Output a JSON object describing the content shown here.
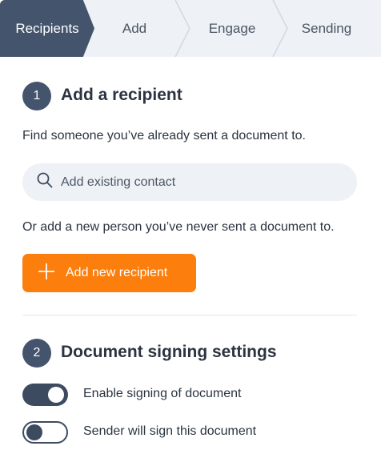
{
  "steps": [
    {
      "label": "Recipients",
      "active": true
    },
    {
      "label": "Add",
      "active": false
    },
    {
      "label": "Engage",
      "active": false
    },
    {
      "label": "Sending",
      "active": false
    }
  ],
  "section1": {
    "number": "1",
    "title": "Add a recipient",
    "find_text": "Find someone you’ve already sent a document to.",
    "search_placeholder": "Add existing contact",
    "or_text": "Or add a new person you’ve never sent a document to.",
    "add_button_label": "Add new recipient"
  },
  "section2": {
    "number": "2",
    "title": "Document signing settings",
    "toggles": [
      {
        "label": "Enable signing of document",
        "on": true
      },
      {
        "label": "Sender will sign this document",
        "on": false
      }
    ]
  },
  "colors": {
    "accent": "#fc7e0d",
    "primary_dark": "#44546c",
    "step_bg": "#eef1f5"
  }
}
